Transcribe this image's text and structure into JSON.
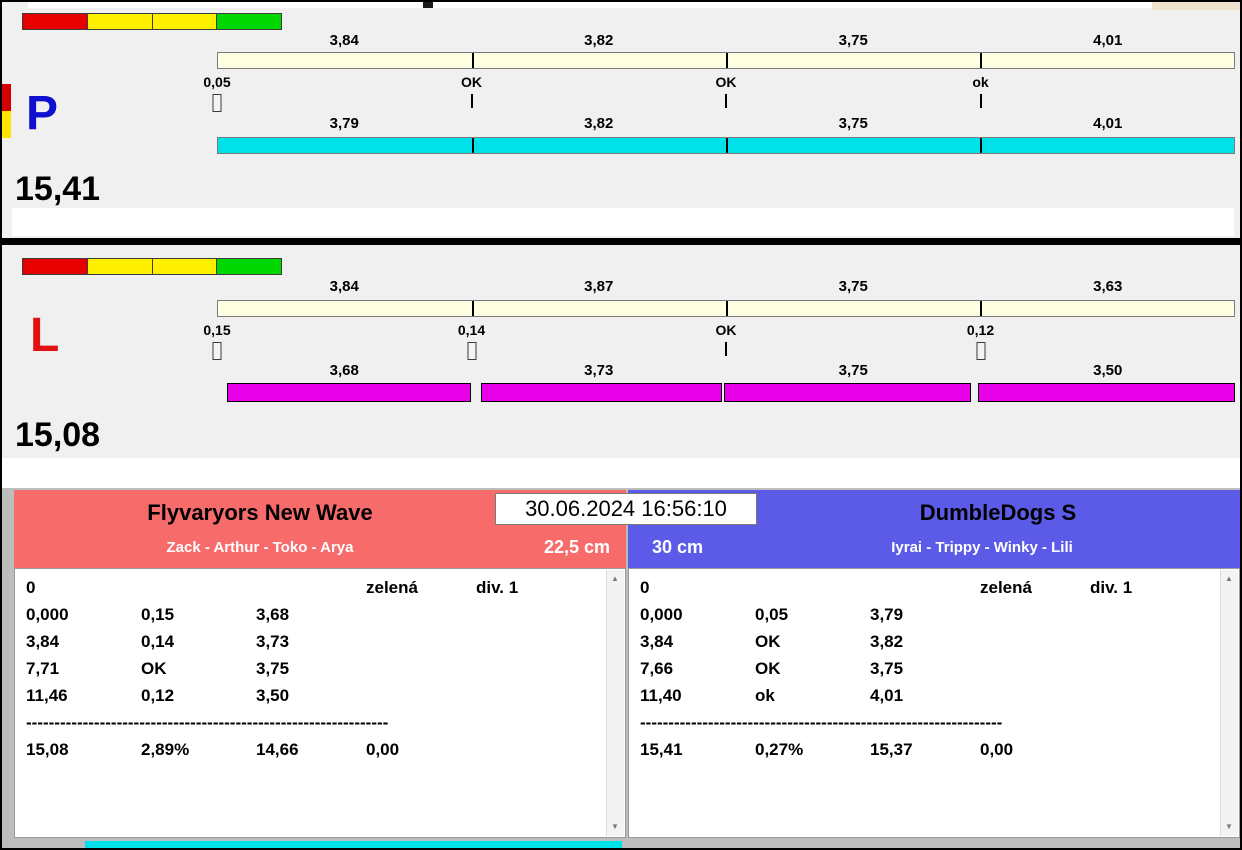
{
  "timestamp": "30.06.2024 16:56:10",
  "icons": {
    "scroll_up": "▲",
    "scroll_down": "▼"
  },
  "colors": {
    "lights": [
      "#e60000",
      "#fff000",
      "#fff000",
      "#00d600"
    ],
    "upper_bar": "#ffffe1",
    "lane_p_bar": "#00e2ea",
    "lane_l_bar": "#e800e8",
    "lane_p_letter": "#0f0fd0",
    "lane_l_letter": "#e01212",
    "team_left_header": "#f86b6b",
    "team_right_header": "#5b5be8"
  },
  "lane_p": {
    "letter": "P",
    "total": "15,41",
    "upper_values": [
      "3,84",
      "3,82",
      "3,75",
      "4,01"
    ],
    "marks": [
      "0,05",
      "OK",
      "OK",
      "ok"
    ],
    "lower_values": [
      "3,79",
      "3,82",
      "3,75",
      "4,01"
    ]
  },
  "lane_l": {
    "letter": "L",
    "total": "15,08",
    "upper_values": [
      "3,84",
      "3,87",
      "3,75",
      "3,63"
    ],
    "marks": [
      "0,15",
      "0,14",
      "OK",
      "0,12"
    ],
    "lower_values": [
      "3,68",
      "3,73",
      "3,75",
      "3,50"
    ]
  },
  "team_left": {
    "name": "Flyvaryors New Wave",
    "members": "Zack - Arthur - Toko - Arya",
    "jump_height": "22,5 cm",
    "info": {
      "start": "0",
      "status": "zelená",
      "division": "div. 1"
    },
    "splits": [
      [
        "0,000",
        "0,15",
        "3,68"
      ],
      [
        "3,84",
        "0,14",
        "3,73"
      ],
      [
        "7,71",
        "OK",
        "3,75"
      ],
      [
        "11,46",
        "0,12",
        "3,50"
      ]
    ],
    "separator": "----------------------------------------------------------------",
    "totals": [
      "15,08",
      "2,89%",
      "14,66",
      "0,00"
    ]
  },
  "team_right": {
    "name": "DumbleDogs S",
    "members": "Iyrai - Trippy - Winky - Lili",
    "jump_height": "30 cm",
    "info": {
      "start": "0",
      "status": "zelená",
      "division": "div. 1"
    },
    "splits": [
      [
        "0,000",
        "0,05",
        "3,79"
      ],
      [
        "3,84",
        "OK",
        "3,82"
      ],
      [
        "7,66",
        "OK",
        "3,75"
      ],
      [
        "11,40",
        "ok",
        "4,01"
      ]
    ],
    "separator": "----------------------------------------------------------------",
    "totals": [
      "15,41",
      "0,27%",
      "15,37",
      "0,00"
    ]
  }
}
